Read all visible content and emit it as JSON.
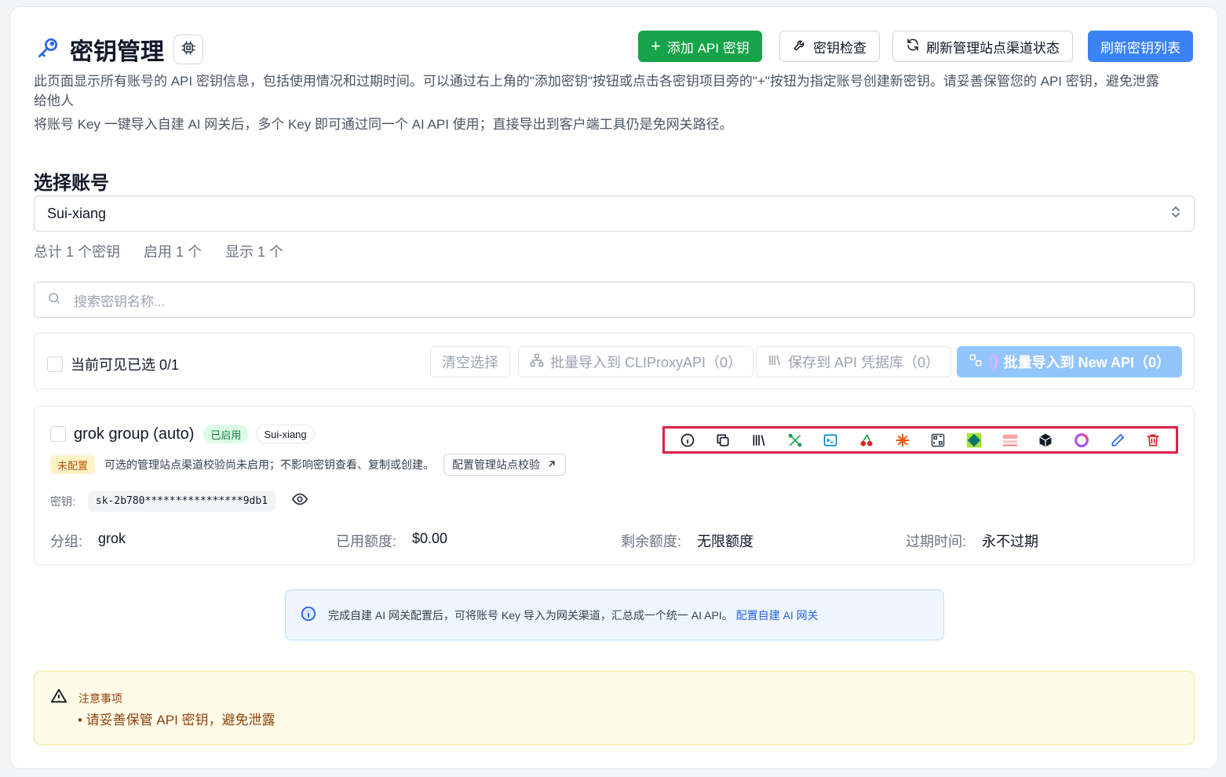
{
  "header": {
    "title": "密钥管理",
    "add_key_label": "添加 API 密钥",
    "key_check_label": "密钥检查",
    "refresh_channels_label": "刷新管理站点渠道状态",
    "refresh_list_label": "刷新密钥列表"
  },
  "description": {
    "line1": "此页面显示所有账号的 API 密钥信息，包括使用情况和过期时间。可以通过右上角的\"添加密钥\"按钮或点击各密钥项目旁的\"+\"按钮为指定账号创建新密钥。请妥善保管您的 API 密钥，避免泄露",
    "line1b": "给他人",
    "line2": "将账号 Key 一键导入自建 AI 网关后，多个 Key 即可通过同一个 AI API 使用；直接导出到客户端工具仍是免网关路径。"
  },
  "account": {
    "section_title": "选择账号",
    "selected": "Sui-xiang"
  },
  "stats": {
    "total": "总计 1 个密钥",
    "enabled": "启用 1 个",
    "shown": "显示 1 个"
  },
  "search": {
    "placeholder": "搜索密钥名称..."
  },
  "toolbar": {
    "selected_label": "当前可见已选 0/1",
    "clear_label": "清空选择",
    "import_cliproxy_label": "批量导入到 CLIProxyAPI（0）",
    "save_vault_label": "保存到 API 凭据库（0）",
    "import_newapi_label": "批量导入到 New API（0）"
  },
  "key_item": {
    "name": "grok group (auto)",
    "status_badge": "已启用",
    "account_badge": "Sui-xiang",
    "unconfigured_badge": "未配置",
    "unconfigured_note": "可选的管理站点渠道校验尚未启用；不影响密钥查看、复制或创建。",
    "config_link": "配置管理站点校验",
    "key_label": "密钥:",
    "key_value": "sk-2b780****************9db1",
    "group_label": "分组:",
    "group_value": "grok",
    "used_label": "已用额度:",
    "used_value": "$0.00",
    "remaining_label": "剩余额度:",
    "remaining_value": "无限额度",
    "expire_label": "过期时间:",
    "expire_value": "永不过期",
    "actions": [
      "info-icon",
      "copy-icon",
      "library-icon",
      "tools-icon",
      "terminal-icon",
      "cherry-icon",
      "sparkle-icon",
      "qr-code-icon",
      "diamond-logo-icon",
      "brand-logo-icon",
      "cube-icon",
      "ring-logo-icon",
      "edit-icon",
      "delete-icon"
    ]
  },
  "info": {
    "text": "完成自建 AI 网关配置后，可将账号 Key 导入为网关渠道，汇总成一个统一 AI API。",
    "link": "配置自建 AI 网关"
  },
  "warning": {
    "title": "注意事项",
    "item": "• 请妥善保管 API 密钥，避免泄露"
  },
  "colors": {
    "primary": "#3b82f6",
    "success": "#16a34a",
    "danger": "#e11d48",
    "warning_bg": "#fefce8"
  }
}
